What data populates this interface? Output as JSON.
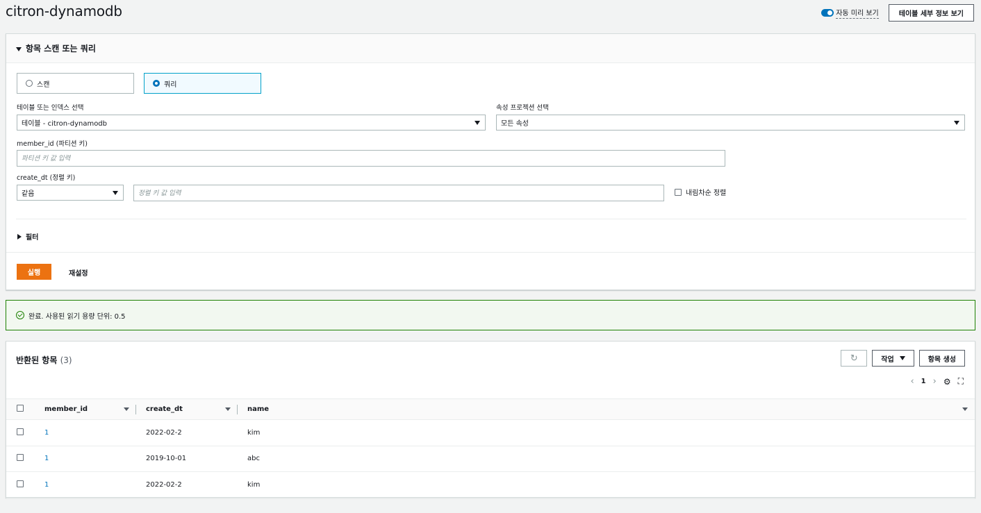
{
  "page": {
    "title": "citron-dynamodb",
    "auto_preview_label": "자동 미리 보기",
    "table_details_button": "테이블 세부 정보 보기"
  },
  "query_panel": {
    "title": "항목 스캔 또는 쿼리",
    "mode_options": [
      {
        "label": "스캔",
        "selected": false
      },
      {
        "label": "쿼리",
        "selected": true
      }
    ],
    "table_index_label": "테이블 또는 인덱스 선택",
    "table_index_value": "테이블 - citron-dynamodb",
    "projection_label": "속성 프로젝션 선택",
    "projection_value": "모든 속성",
    "partition_key_label": "member_id (파티션 키)",
    "partition_key_placeholder": "파티션 키 값 입력",
    "sort_key_label": "create_dt (정렬 키)",
    "sort_condition_value": "같음",
    "sort_key_placeholder": "정렬 키 값 입력",
    "descending_label": "내림차순 정렬",
    "filter_label": "필터",
    "run_button": "실행",
    "reset_button": "재설정"
  },
  "alert": {
    "message": "완료. 사용된 읽기 용량 단위: 0.5",
    "status_color": "#1d8102"
  },
  "results": {
    "title": "반환된 항목",
    "count": "(3)",
    "refresh_icon": "refresh-icon",
    "actions_button": "작업",
    "create_item_button": "항목 생성",
    "page_number": "1",
    "columns": [
      "member_id",
      "create_dt",
      "name"
    ],
    "rows": [
      {
        "member_id": "1",
        "create_dt": "2022-02-2",
        "name": "kim"
      },
      {
        "member_id": "1",
        "create_dt": "2019-10-01",
        "name": "abc"
      },
      {
        "member_id": "1",
        "create_dt": "2022-02-2",
        "name": "kim"
      }
    ]
  },
  "colors": {
    "accent": "#0073bb",
    "primary_button": "#ec7211"
  }
}
